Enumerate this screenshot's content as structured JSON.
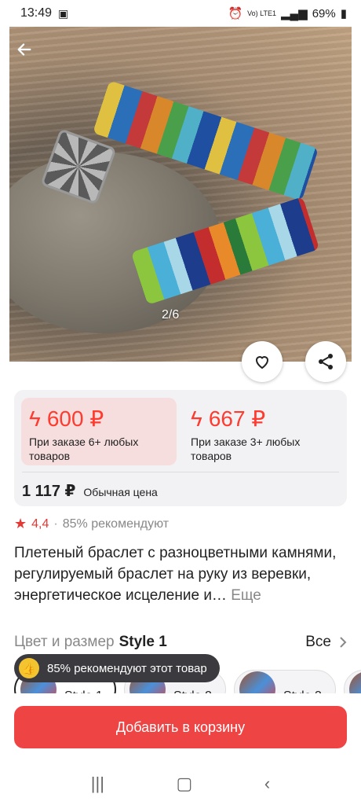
{
  "status": {
    "time": "13:49",
    "battery": "69%",
    "network": "Vo) LTE1"
  },
  "gallery": {
    "counter": "2/6"
  },
  "prices": {
    "tier1": {
      "amount": "600 ₽",
      "note": "При заказе 6+ любых товаров"
    },
    "tier2": {
      "amount": "667 ₽",
      "note": "При заказе 3+ любых товаров"
    },
    "regular": {
      "amount": "1 117 ₽",
      "label": "Обычная цена"
    }
  },
  "rating": {
    "value": "4,4",
    "separator": "·",
    "recommend": "85% рекомендуют"
  },
  "product": {
    "title": "Плетеный браслет с разноцветными камнями, регулируемый браслет на руку из веревки, энергетическое исцеление и…",
    "more": "Еще"
  },
  "variant": {
    "label": "Цвет и размер",
    "selected": "Style 1",
    "all": "Все",
    "options": [
      "Style 1",
      "Style 2",
      "Style 3"
    ]
  },
  "toast": {
    "text": "85% рекомендуют этот товар"
  },
  "cta": {
    "label": "Добавить в корзину"
  },
  "colors": {
    "accent": "#ef4444",
    "price": "#ff3b30",
    "tier_bg": "#f7dede"
  },
  "icons": [
    "back-arrow",
    "heart",
    "share",
    "star",
    "thumbs-up",
    "chevron-right"
  ]
}
